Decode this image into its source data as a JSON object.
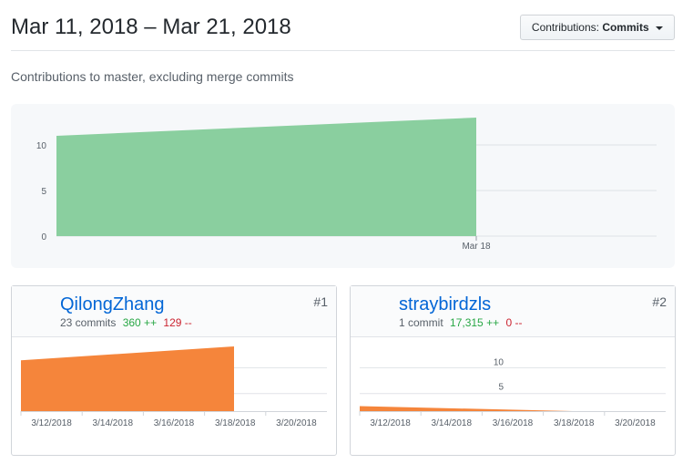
{
  "header": {
    "date_range": "Mar 11, 2018 – Mar 21, 2018",
    "contributions_label": "Contributions:",
    "contributions_value": "Commits"
  },
  "subtitle": "Contributions to master, excluding merge commits",
  "colors": {
    "main_fill": "#8acf9f",
    "contributor_fill": "#f5853b",
    "additions": "#28a745",
    "deletions": "#cb2431",
    "link": "#0366d6"
  },
  "chart_data": [
    {
      "type": "area",
      "x": [
        "Mar 11",
        "Mar 18"
      ],
      "values": [
        11,
        13
      ],
      "ylim": [
        0,
        13.5
      ],
      "y_ticks": [
        0,
        5,
        10
      ],
      "x_ticks": [
        "Mar 18"
      ],
      "grid": true
    },
    {
      "type": "area",
      "x": [
        "3/11/2018",
        "3/18/2018"
      ],
      "values": [
        11,
        14
      ],
      "ylim": [
        0,
        14
      ],
      "x_ticks": [
        "3/12/2018",
        "3/14/2018",
        "3/16/2018",
        "3/18/2018",
        "3/20/2018"
      ],
      "grid": true
    },
    {
      "type": "area",
      "x": [
        "3/11/2018",
        "3/18/2018"
      ],
      "values": [
        1,
        0
      ],
      "ylim": [
        0,
        13
      ],
      "y_ticks": [
        5,
        10
      ],
      "x_ticks": [
        "3/12/2018",
        "3/14/2018",
        "3/16/2018",
        "3/18/2018",
        "3/20/2018"
      ],
      "grid": true
    }
  ],
  "contributors": [
    {
      "username": "QilongZhang",
      "commits": "23 commits",
      "additions": "360 ++",
      "deletions": "129 --",
      "rank": "#1",
      "avatar_icon": "user-avatar-photo"
    },
    {
      "username": "straybirdzls",
      "commits": "1 commit",
      "additions": "17,315 ++",
      "deletions": "0 --",
      "rank": "#2",
      "avatar_icon": "user-avatar-illustration"
    }
  ]
}
